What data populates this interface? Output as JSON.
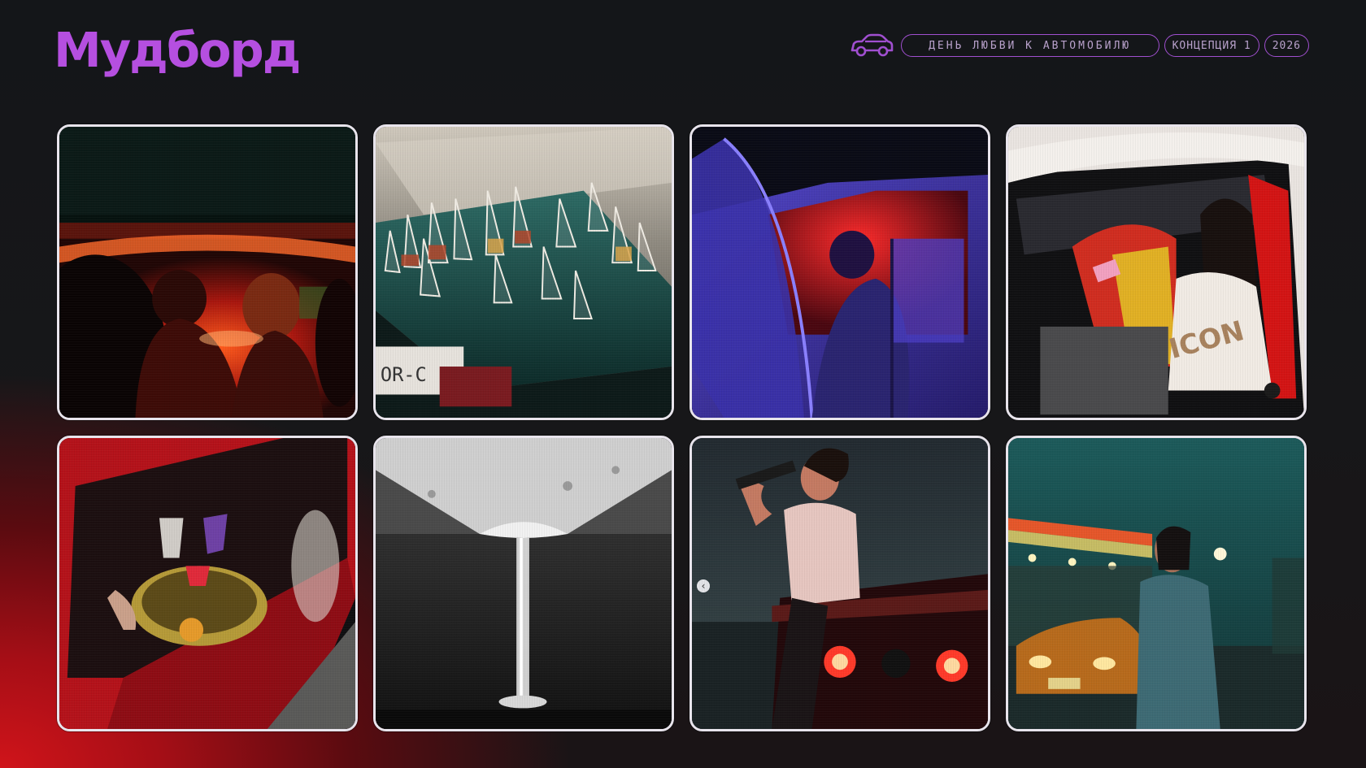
{
  "header": {
    "title": "Мудборд",
    "car_icon": "car-icon",
    "tag_event": "ДЕНЬ ЛЮБВИ К АВТОМОБИЛЮ",
    "tag_concept": "КОНЦЕПЦИЯ 1",
    "tag_year": "2026"
  },
  "colors": {
    "accent": "#b54fe0",
    "pill_border": "#a04fd0",
    "pill_text": "#b9a2cc",
    "background": "#151719",
    "gradient_red": "#d0141a",
    "tile_border": "#e8e4ec"
  },
  "moodboard": {
    "tiles": [
      {
        "subject": "couple-in-car-red-light"
      },
      {
        "subject": "glasses-on-car-trunk"
      },
      {
        "subject": "car-open-door-neon"
      },
      {
        "subject": "woman-in-race-car-lipstick"
      },
      {
        "subject": "tray-of-drinks-at-red-car"
      },
      {
        "subject": "bw-wine-glass-stem"
      },
      {
        "subject": "man-drinking-on-car-tail"
      },
      {
        "subject": "woman-at-gas-station"
      }
    ],
    "carousel_prev_icon": "chevron-left-icon",
    "carousel_prev_glyph": "‹"
  },
  "plate_text": "OR-C"
}
